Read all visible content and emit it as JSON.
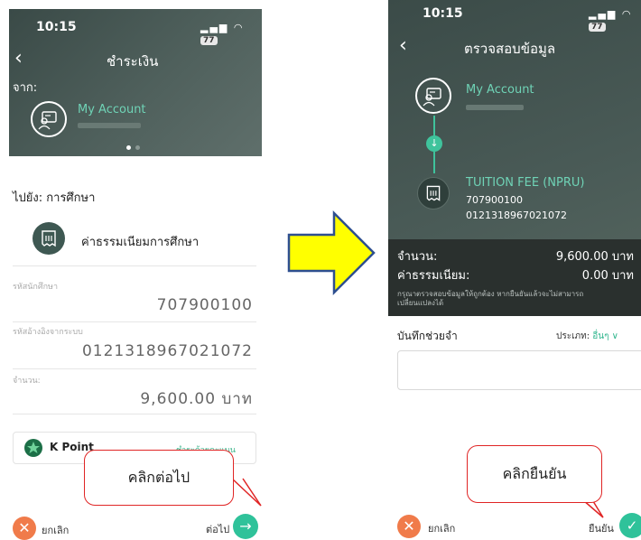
{
  "left": {
    "status_time": "10:15",
    "battery": "77",
    "title": "ชำระเงิน",
    "from_label": "จาก:",
    "account_name": "My Account",
    "to_label": "ไปยัง: การศึกษา",
    "biller_name": "ค่าธรรมเนียมการศึกษา",
    "fields": [
      {
        "label": "รหัสนักศึกษา",
        "value": "707900100"
      },
      {
        "label": "รหัสอ้างอิงจากระบบ",
        "value": "0121318967021072"
      },
      {
        "label": "จำนวน:",
        "value": "9,600.00 บาท"
      }
    ],
    "kpoint_label": "K Point",
    "kpoint_link": "ชำระด้วยคะแนน",
    "cancel_label": "ยกเลิก",
    "next_label": "ต่อไป"
  },
  "right": {
    "status_time": "10:15",
    "battery": "77",
    "title": "ตรวจสอบข้อมูล",
    "account_name": "My Account",
    "tuition_name": "TUITION FEE (NPRU)",
    "tuition_id": "707900100",
    "tuition_ref": "0121318967021072",
    "amount_label": "จำนวน:",
    "amount_value": "9,600.00 บาท",
    "fee_label": "ค่าธรรมเนียม:",
    "fee_value": "0.00 บาท",
    "note": "กรุณาตรวจสอบข้อมูลให้ถูกต้อง หากยืนยันแล้วจะไม่สามารถเปลี่ยนแปลงได้",
    "memo_label": "บันทึกช่วยจำ",
    "type_prefix": "ประเภท:",
    "type_value": "อื่นๆ",
    "cancel_label": "ยกเลิก",
    "confirm_label": "ยืนยัน"
  },
  "callouts": {
    "next": "คลิกต่อไป",
    "confirm": "คลิกยืนยัน"
  },
  "colors": {
    "accent_green": "#2fc29a",
    "cancel_orange": "#f07b4a",
    "arrow_yellow": "#ffff00",
    "arrow_border": "#2e4f8f",
    "callout_border": "#e02525"
  }
}
